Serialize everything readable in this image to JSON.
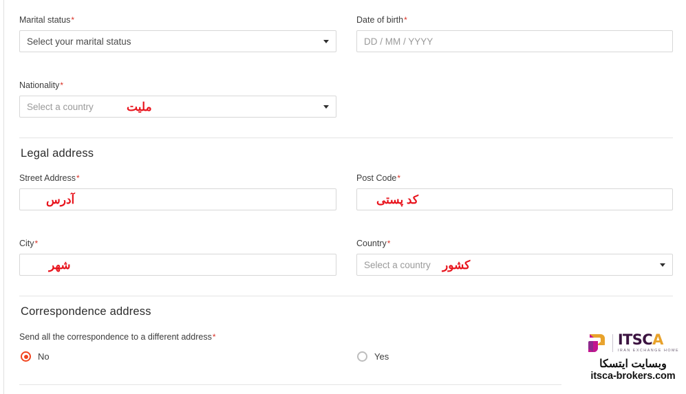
{
  "form": {
    "fields": {
      "marital_status": {
        "label": "Marital status",
        "required_mark": "*",
        "value": "Select your marital status",
        "type": "select"
      },
      "date_of_birth": {
        "label": "Date of birth",
        "required_mark": "*",
        "placeholder": "DD / MM / YYYY",
        "type": "text"
      },
      "nationality": {
        "label": "Nationality",
        "required_mark": "*",
        "placeholder": "Select a country",
        "annotation": "ملیت",
        "type": "select"
      },
      "street_address": {
        "label": "Street Address",
        "required_mark": "*",
        "value": "",
        "annotation": "آدرس",
        "type": "text"
      },
      "post_code": {
        "label": "Post Code",
        "required_mark": "*",
        "value": "",
        "annotation": "کد پستی",
        "type": "text"
      },
      "city": {
        "label": "City",
        "required_mark": "*",
        "value": "",
        "annotation": "شهر",
        "type": "text"
      },
      "country": {
        "label": "Country",
        "required_mark": "*",
        "placeholder": "Select a country",
        "annotation": "کشور",
        "type": "select"
      }
    },
    "sections": {
      "legal_address": {
        "title": "Legal address"
      },
      "correspondence_address": {
        "title": "Correspondence address",
        "question": "Send all the correspondence to a different address",
        "required_mark": "*",
        "options": [
          {
            "label": "No",
            "selected": true
          },
          {
            "label": "Yes",
            "selected": false
          }
        ]
      }
    }
  },
  "watermark": {
    "brand_initials": "ITSC",
    "brand_accent_letter": "A",
    "tagline": "IRAN EXCHANGE HOME",
    "farsi_line": "وبسایت ایتسکا",
    "url": "itsca-brokers.com"
  },
  "colors": {
    "required_asterisk": "#d93025",
    "annotation_red": "#e8131c",
    "radio_selected": "#f1441e",
    "field_border": "#d7d7d7",
    "divider": "#e4e4e4",
    "brand_purple": "#3b1340",
    "brand_gold": "#e8a22b",
    "brand_magenta": "#c3168f"
  }
}
